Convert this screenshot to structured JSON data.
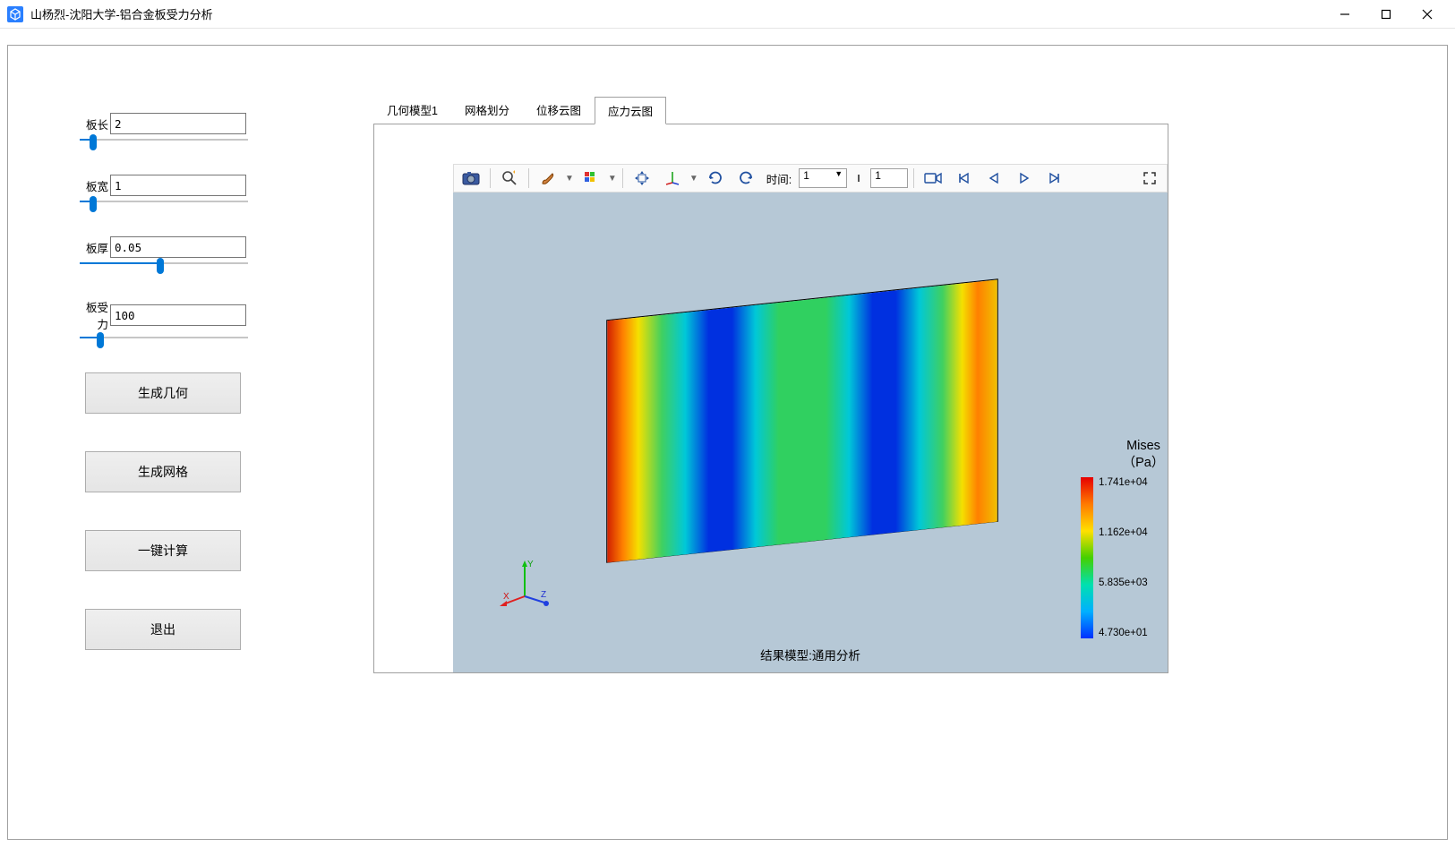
{
  "window": {
    "title": "山杨烈-沈阳大学-铝合金板受力分析"
  },
  "params": {
    "length": {
      "label": "板长",
      "value": "2",
      "fill_pct": 6
    },
    "width": {
      "label": "板宽",
      "value": "1",
      "fill_pct": 6
    },
    "thick": {
      "label": "板厚",
      "value": "0.05",
      "fill_pct": 46
    },
    "force": {
      "label": "板受力",
      "value": "100",
      "fill_pct": 10
    }
  },
  "buttons": {
    "gen_geom": "生成几何",
    "gen_mesh": "生成网格",
    "compute": "一键计算",
    "exit": "退出"
  },
  "tabs": [
    "几何模型1",
    "网格划分",
    "位移云图",
    "应力云图"
  ],
  "active_tab_index": 3,
  "toolbar": {
    "time_label": "时间:",
    "time_value": "1",
    "step_value": "1"
  },
  "viewport": {
    "caption": "结果模型:通用分析",
    "axes": {
      "x": "X",
      "y": "Y",
      "z": "Z"
    }
  },
  "legend": {
    "title_line1": "Mises",
    "title_line2": "（Pa）",
    "ticks": [
      "1.741e+04",
      "1.162e+04",
      "5.835e+03",
      "4.730e+01"
    ]
  },
  "chart_data": {
    "type": "heatmap",
    "title": "Mises stress contour on aluminium plate",
    "quantity": "von Mises stress",
    "unit": "Pa",
    "color_scale": {
      "min": 47.3,
      "max": 17410,
      "stops": [
        {
          "value": 47.3,
          "color": "#0030ff"
        },
        {
          "value": 5835,
          "color": "#00e070"
        },
        {
          "value": 11620,
          "color": "#ffe000"
        },
        {
          "value": 17410,
          "color": "#e60000"
        }
      ]
    },
    "legend_ticks": [
      17410,
      11620,
      5835,
      47.3
    ],
    "field_description": "Plate shows high stress (red/orange) at the left and right edges, two vertical low-stress bands (blue) roughly at 1/4 and 3/4 of the plate width, and moderate stress (green) in the central region."
  }
}
